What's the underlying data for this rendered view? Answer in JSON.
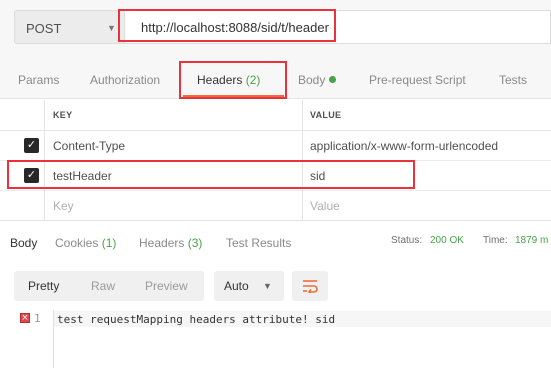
{
  "request": {
    "method": "POST",
    "url": "http://localhost:8088/sid/t/header"
  },
  "request_tabs": [
    {
      "label": "Params"
    },
    {
      "label": "Authorization"
    },
    {
      "label": "Headers",
      "count": "(2)"
    },
    {
      "label": "Body"
    },
    {
      "label": "Pre-request Script"
    },
    {
      "label": "Tests"
    }
  ],
  "headers_table": {
    "col_key": "KEY",
    "col_value": "VALUE",
    "rows": [
      {
        "key": "Content-Type",
        "value": "application/x-www-form-urlencoded",
        "checked": true
      },
      {
        "key": "testHeader",
        "value": "sid",
        "checked": true
      }
    ],
    "placeholder_key": "Key",
    "placeholder_value": "Value"
  },
  "response_tabs": [
    {
      "label": "Body"
    },
    {
      "label": "Cookies",
      "count": "(1)"
    },
    {
      "label": "Headers",
      "count": "(3)"
    },
    {
      "label": "Test Results"
    }
  ],
  "status": {
    "status_label": "Status:",
    "status_value": "200 OK",
    "time_label": "Time:",
    "time_value": "1879 m"
  },
  "response_view": {
    "modes": [
      "Pretty",
      "Raw",
      "Preview"
    ],
    "format": "Auto"
  },
  "response_body": {
    "line_number": "1",
    "text": "test requestMapping headers attribute! sid"
  },
  "colors": {
    "accent": "#f26b3a",
    "highlight_box": "#e8323c",
    "count_green": "#47a449"
  }
}
